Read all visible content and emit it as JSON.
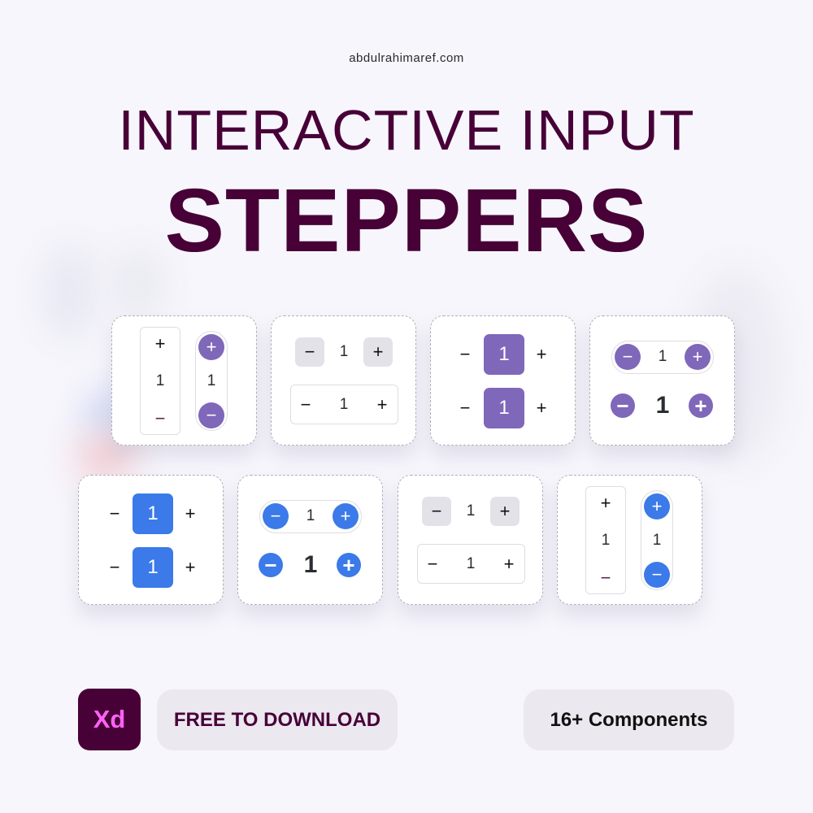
{
  "site": "abdulrahimaref.com",
  "title": {
    "line1": "INTERACTIVE INPUT",
    "line2": "STEPPERS"
  },
  "colors": {
    "brand": "#470137",
    "purple": "#7f67b9",
    "blue": "#3b7ae8",
    "gray_button": "#e3e2e8",
    "xd_pink": "#ff61f6"
  },
  "glyphs": {
    "plus": "+",
    "minus": "−"
  },
  "value": "1",
  "cards": [
    {
      "name": "vertical-steppers-purple",
      "theme": "purple",
      "values": [
        "1",
        "1"
      ]
    },
    {
      "name": "horizontal-gray-steppers-a",
      "theme": "gray",
      "values": [
        "1",
        "1"
      ]
    },
    {
      "name": "filled-square-steppers-purple",
      "theme": "purple",
      "values": [
        "1",
        "1"
      ]
    },
    {
      "name": "round-steppers-purple",
      "theme": "purple",
      "values": [
        "1",
        "1"
      ]
    },
    {
      "name": "filled-square-steppers-blue",
      "theme": "blue",
      "values": [
        "1",
        "1"
      ]
    },
    {
      "name": "round-steppers-blue",
      "theme": "blue",
      "values": [
        "1",
        "1"
      ]
    },
    {
      "name": "horizontal-gray-steppers-b",
      "theme": "gray",
      "values": [
        "1",
        "1"
      ]
    },
    {
      "name": "vertical-steppers-blue",
      "theme": "blue",
      "values": [
        "1",
        "1"
      ]
    }
  ],
  "footer": {
    "xd_logo": "Xd",
    "download_label": "FREE TO DOWNLOAD",
    "components_label": "16+ Components"
  }
}
